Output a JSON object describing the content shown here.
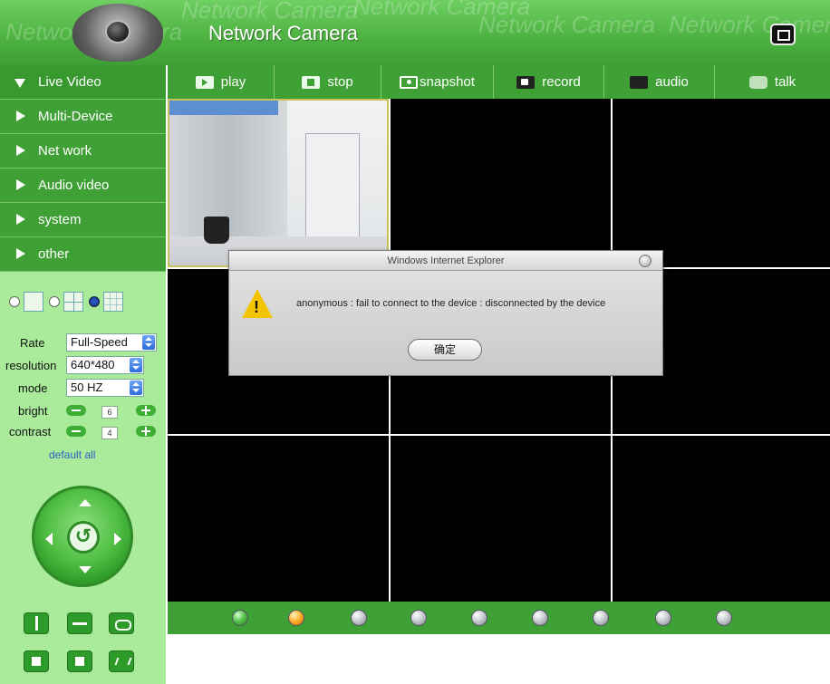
{
  "header": {
    "title": "Network Camera",
    "watermark": "Network Camera"
  },
  "menu": {
    "items": [
      {
        "label": "Live Video",
        "active": true
      },
      {
        "label": "Multi-Device",
        "active": false
      },
      {
        "label": "Net work",
        "active": false
      },
      {
        "label": "Audio video",
        "active": false
      },
      {
        "label": "system",
        "active": false
      },
      {
        "label": "other",
        "active": false
      }
    ]
  },
  "controls": {
    "rate_label": "Rate",
    "rate_value": "Full-Speed",
    "resolution_label": "resolution",
    "resolution_value": "640*480",
    "mode_label": "mode",
    "mode_value": "50 HZ",
    "bright_label": "bright",
    "bright_value": "6",
    "contrast_label": "contrast",
    "contrast_value": "4",
    "default_all": "default all"
  },
  "toolbar": {
    "play": "play",
    "stop": "stop",
    "snapshot": "snapshot",
    "record": "record",
    "audio": "audio",
    "talk": "talk"
  },
  "dialog": {
    "title": "Windows Internet Explorer",
    "message": "anonymous : fail to connect to the device : disconnected by the device",
    "ok": "确定"
  },
  "status_dots": [
    "green",
    "orange",
    "gray",
    "gray",
    "gray",
    "gray",
    "gray",
    "gray",
    "gray"
  ],
  "colors": {
    "accent": "#3fa035",
    "panel": "#a9eb9a",
    "warning": "#f5c400"
  }
}
